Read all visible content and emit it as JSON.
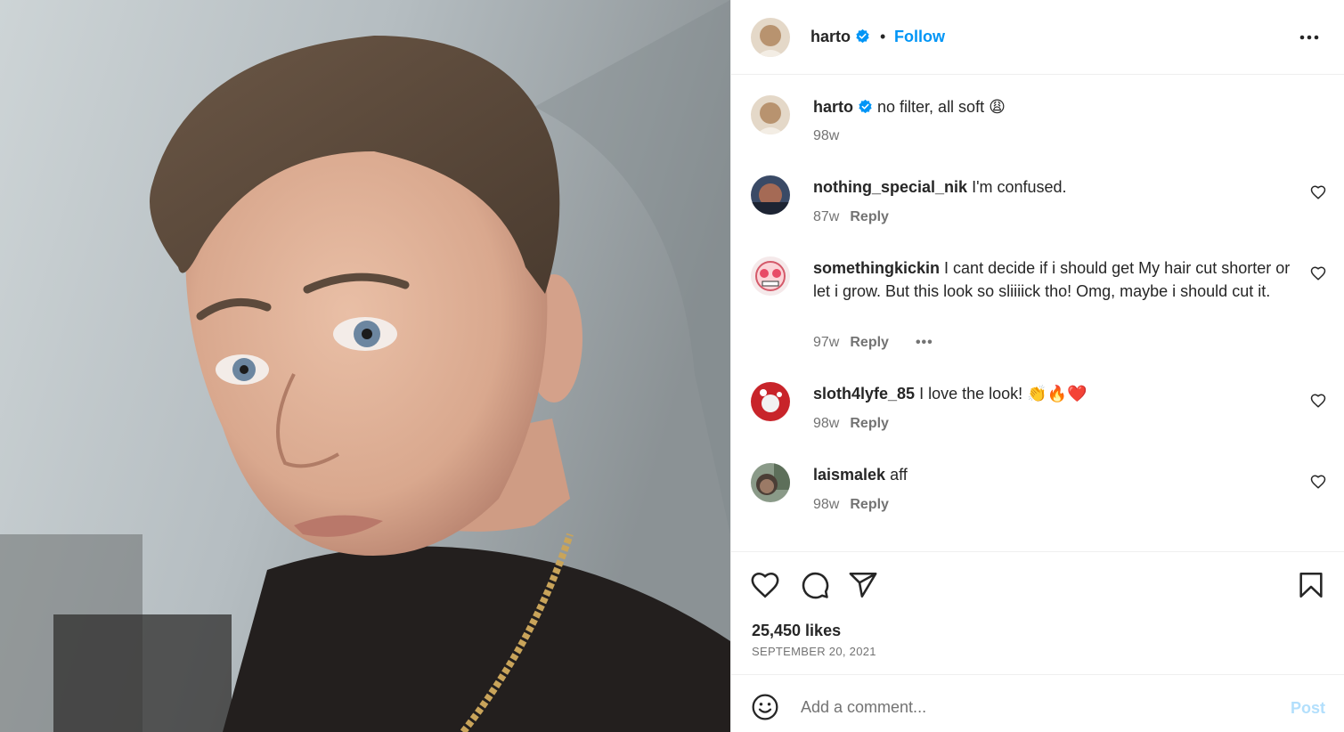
{
  "post": {
    "author": "harto",
    "follow_label": "Follow",
    "separator": "•",
    "caption_user": "harto",
    "caption_text": "no filter, all soft 😩",
    "caption_time": "98w"
  },
  "comments": [
    {
      "user": "nothing_special_nik",
      "text": "I'm confused.",
      "time": "87w",
      "reply": "Reply"
    },
    {
      "user": "somethingkickin",
      "text": "I cant decide if i should get My hair cut shorter or let i grow. But this look so sliiiick tho! Omg, maybe i should cut it.",
      "time": "97w",
      "reply": "Reply",
      "more": "•••"
    },
    {
      "user": "sloth4lyfe_85",
      "text": "I love the look! 👏🔥❤️",
      "time": "98w",
      "reply": "Reply"
    },
    {
      "user": "laismalek",
      "text": "aff",
      "time": "98w",
      "reply": "Reply"
    }
  ],
  "stats": {
    "likes": "25,450 likes",
    "date": "SEPTEMBER 20, 2021"
  },
  "composer": {
    "placeholder": "Add a comment...",
    "post_label": "Post"
  },
  "icons": {
    "verified": "verified-badge-icon",
    "more": "more-options-icon",
    "like": "heart-icon",
    "comment": "comment-bubble-icon",
    "share": "paper-plane-icon",
    "save": "bookmark-icon",
    "emoji": "emoji-smiley-icon"
  },
  "colors": {
    "accent": "#0095f6",
    "verified": "#0095f6",
    "post_disabled": "#b2dffc",
    "muted": "#737373",
    "text": "#262626"
  }
}
